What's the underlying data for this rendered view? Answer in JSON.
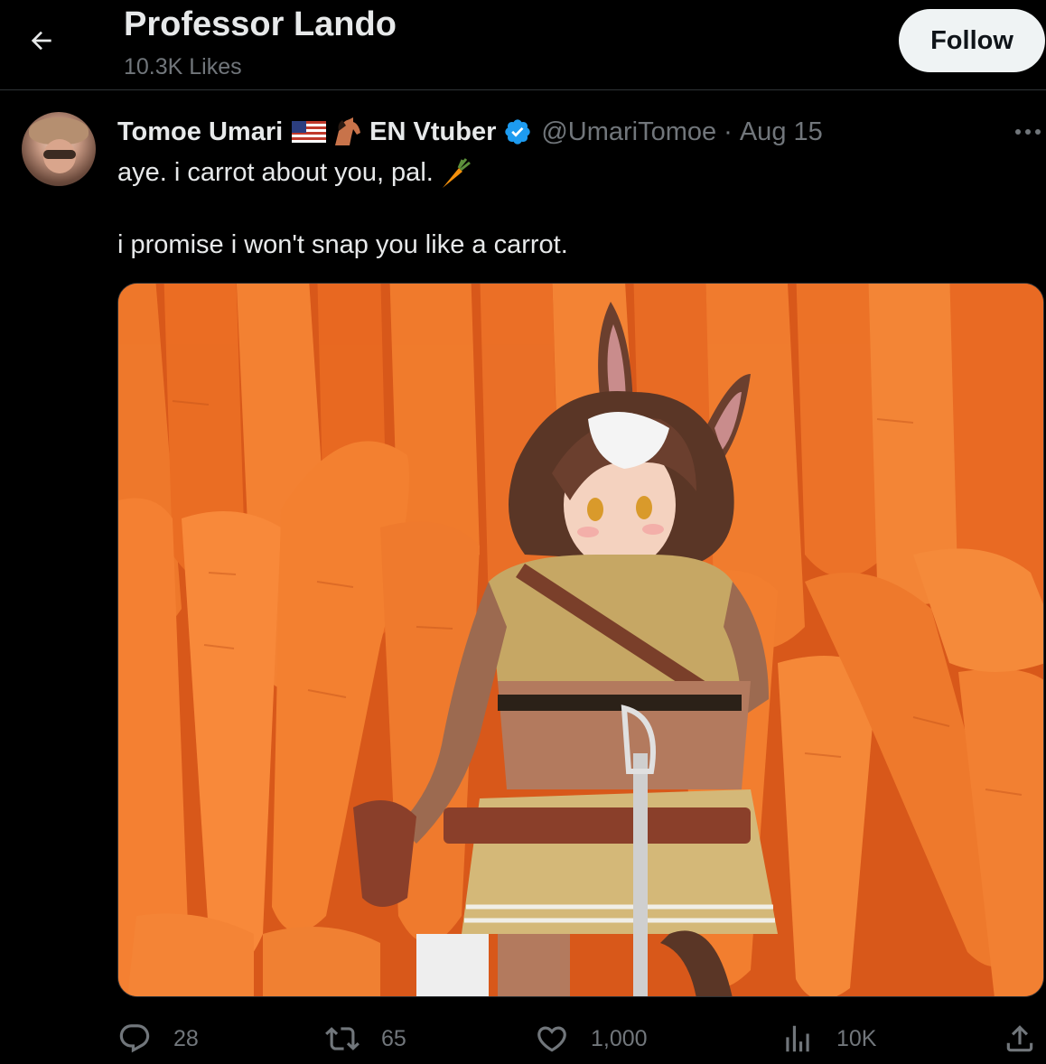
{
  "header": {
    "title": "Professor Lando",
    "likes": "10.3K Likes",
    "follow_label": "Follow"
  },
  "tweet": {
    "display_name": "Tomoe Umari",
    "display_name_suffix": "EN Vtuber",
    "handle": "@UmariTomoe",
    "separator": "·",
    "date": "Aug 15",
    "text_line1": "aye. i carrot about you, pal.",
    "text_line2": "i promise i won't snap you like a carrot.",
    "icons": [
      "us-flag-icon",
      "horse-icon",
      "verified-badge-icon",
      "carrot-emoji",
      "more-icon"
    ]
  },
  "actions": {
    "replies": "28",
    "reposts": "65",
    "likes": "1,000",
    "views": "10K"
  },
  "colors": {
    "background": "#000000",
    "text": "#e7e9ea",
    "muted": "#71767b",
    "verified": "#1d9bf0",
    "follow_bg": "#eff3f4",
    "border": "#2f3336"
  }
}
